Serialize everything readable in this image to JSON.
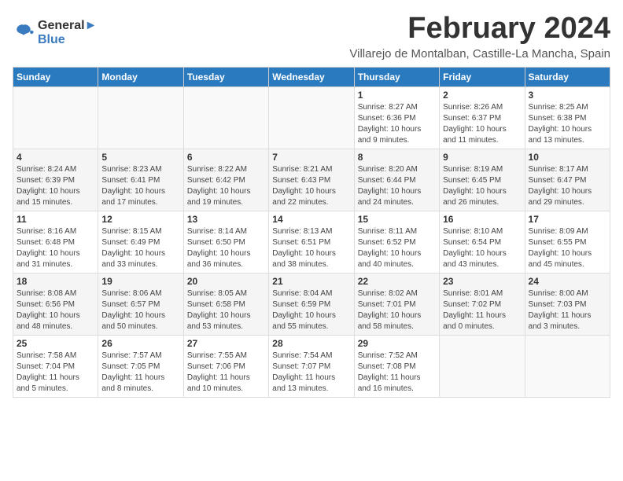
{
  "logo": {
    "line1": "General",
    "line2": "Blue"
  },
  "title": "February 2024",
  "subtitle": "Villarejo de Montalban, Castille-La Mancha, Spain",
  "header_days": [
    "Sunday",
    "Monday",
    "Tuesday",
    "Wednesday",
    "Thursday",
    "Friday",
    "Saturday"
  ],
  "weeks": [
    [
      {
        "day": "",
        "info": ""
      },
      {
        "day": "",
        "info": ""
      },
      {
        "day": "",
        "info": ""
      },
      {
        "day": "",
        "info": ""
      },
      {
        "day": "1",
        "info": "Sunrise: 8:27 AM\nSunset: 6:36 PM\nDaylight: 10 hours\nand 9 minutes."
      },
      {
        "day": "2",
        "info": "Sunrise: 8:26 AM\nSunset: 6:37 PM\nDaylight: 10 hours\nand 11 minutes."
      },
      {
        "day": "3",
        "info": "Sunrise: 8:25 AM\nSunset: 6:38 PM\nDaylight: 10 hours\nand 13 minutes."
      }
    ],
    [
      {
        "day": "4",
        "info": "Sunrise: 8:24 AM\nSunset: 6:39 PM\nDaylight: 10 hours\nand 15 minutes."
      },
      {
        "day": "5",
        "info": "Sunrise: 8:23 AM\nSunset: 6:41 PM\nDaylight: 10 hours\nand 17 minutes."
      },
      {
        "day": "6",
        "info": "Sunrise: 8:22 AM\nSunset: 6:42 PM\nDaylight: 10 hours\nand 19 minutes."
      },
      {
        "day": "7",
        "info": "Sunrise: 8:21 AM\nSunset: 6:43 PM\nDaylight: 10 hours\nand 22 minutes."
      },
      {
        "day": "8",
        "info": "Sunrise: 8:20 AM\nSunset: 6:44 PM\nDaylight: 10 hours\nand 24 minutes."
      },
      {
        "day": "9",
        "info": "Sunrise: 8:19 AM\nSunset: 6:45 PM\nDaylight: 10 hours\nand 26 minutes."
      },
      {
        "day": "10",
        "info": "Sunrise: 8:17 AM\nSunset: 6:47 PM\nDaylight: 10 hours\nand 29 minutes."
      }
    ],
    [
      {
        "day": "11",
        "info": "Sunrise: 8:16 AM\nSunset: 6:48 PM\nDaylight: 10 hours\nand 31 minutes."
      },
      {
        "day": "12",
        "info": "Sunrise: 8:15 AM\nSunset: 6:49 PM\nDaylight: 10 hours\nand 33 minutes."
      },
      {
        "day": "13",
        "info": "Sunrise: 8:14 AM\nSunset: 6:50 PM\nDaylight: 10 hours\nand 36 minutes."
      },
      {
        "day": "14",
        "info": "Sunrise: 8:13 AM\nSunset: 6:51 PM\nDaylight: 10 hours\nand 38 minutes."
      },
      {
        "day": "15",
        "info": "Sunrise: 8:11 AM\nSunset: 6:52 PM\nDaylight: 10 hours\nand 40 minutes."
      },
      {
        "day": "16",
        "info": "Sunrise: 8:10 AM\nSunset: 6:54 PM\nDaylight: 10 hours\nand 43 minutes."
      },
      {
        "day": "17",
        "info": "Sunrise: 8:09 AM\nSunset: 6:55 PM\nDaylight: 10 hours\nand 45 minutes."
      }
    ],
    [
      {
        "day": "18",
        "info": "Sunrise: 8:08 AM\nSunset: 6:56 PM\nDaylight: 10 hours\nand 48 minutes."
      },
      {
        "day": "19",
        "info": "Sunrise: 8:06 AM\nSunset: 6:57 PM\nDaylight: 10 hours\nand 50 minutes."
      },
      {
        "day": "20",
        "info": "Sunrise: 8:05 AM\nSunset: 6:58 PM\nDaylight: 10 hours\nand 53 minutes."
      },
      {
        "day": "21",
        "info": "Sunrise: 8:04 AM\nSunset: 6:59 PM\nDaylight: 10 hours\nand 55 minutes."
      },
      {
        "day": "22",
        "info": "Sunrise: 8:02 AM\nSunset: 7:01 PM\nDaylight: 10 hours\nand 58 minutes."
      },
      {
        "day": "23",
        "info": "Sunrise: 8:01 AM\nSunset: 7:02 PM\nDaylight: 11 hours\nand 0 minutes."
      },
      {
        "day": "24",
        "info": "Sunrise: 8:00 AM\nSunset: 7:03 PM\nDaylight: 11 hours\nand 3 minutes."
      }
    ],
    [
      {
        "day": "25",
        "info": "Sunrise: 7:58 AM\nSunset: 7:04 PM\nDaylight: 11 hours\nand 5 minutes."
      },
      {
        "day": "26",
        "info": "Sunrise: 7:57 AM\nSunset: 7:05 PM\nDaylight: 11 hours\nand 8 minutes."
      },
      {
        "day": "27",
        "info": "Sunrise: 7:55 AM\nSunset: 7:06 PM\nDaylight: 11 hours\nand 10 minutes."
      },
      {
        "day": "28",
        "info": "Sunrise: 7:54 AM\nSunset: 7:07 PM\nDaylight: 11 hours\nand 13 minutes."
      },
      {
        "day": "29",
        "info": "Sunrise: 7:52 AM\nSunset: 7:08 PM\nDaylight: 11 hours\nand 16 minutes."
      },
      {
        "day": "",
        "info": ""
      },
      {
        "day": "",
        "info": ""
      }
    ]
  ]
}
